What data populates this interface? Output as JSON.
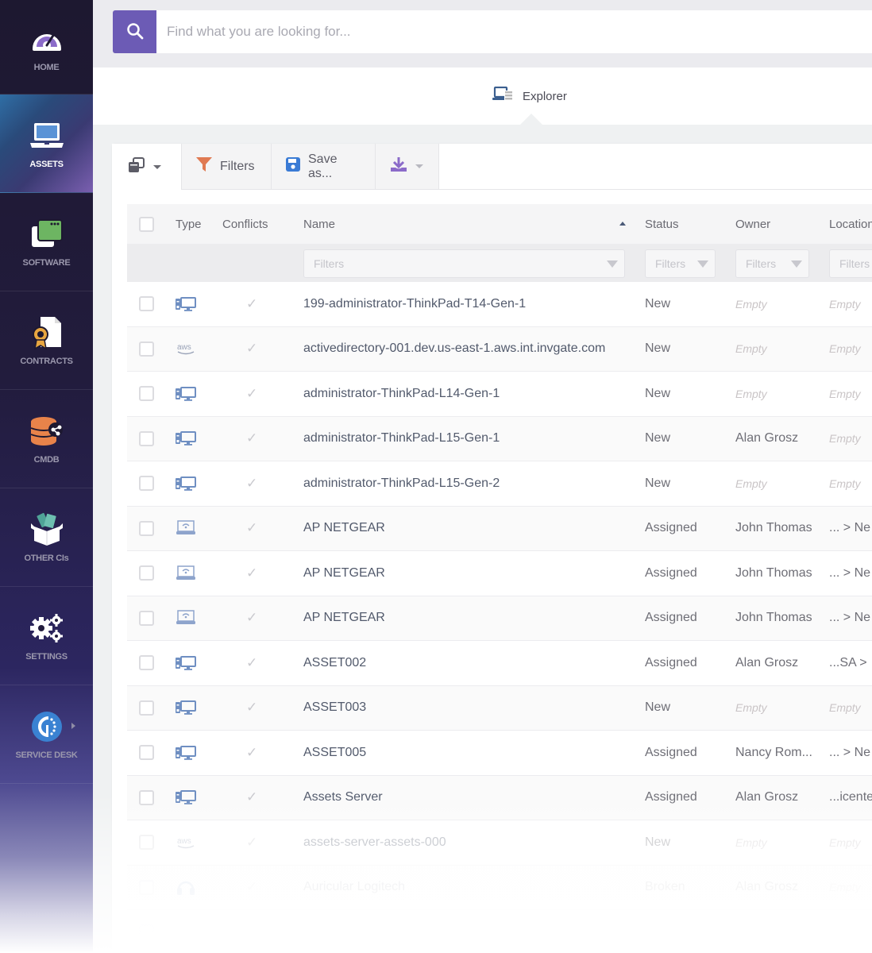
{
  "sidebar": {
    "items": [
      {
        "label": "HOME",
        "icon": "speedometer-icon",
        "active": false
      },
      {
        "label": "ASSETS",
        "icon": "laptop-icon",
        "active": true
      },
      {
        "label": "SOFTWARE",
        "icon": "software-windows-icon",
        "active": false
      },
      {
        "label": "CONTRACTS",
        "icon": "contract-certificate-icon",
        "active": false
      },
      {
        "label": "CMDB",
        "icon": "database-share-icon",
        "active": false
      },
      {
        "label": "OTHER CIs",
        "icon": "open-box-icon",
        "active": false
      },
      {
        "label": "SETTINGS",
        "icon": "gears-icon",
        "active": false
      },
      {
        "label": "SERVICE DESK",
        "icon": "service-desk-logo-icon",
        "active": false,
        "has_submenu": true
      }
    ]
  },
  "search": {
    "placeholder": "Find what you are looking for...",
    "value": "",
    "button_icon": "search-icon",
    "accent_color": "#6c5bb5"
  },
  "tabs": {
    "active": {
      "label": "Explorer",
      "icon": "explorer-icon"
    }
  },
  "toolbar": {
    "view_icon": "view-switch-icon",
    "filters_label": "Filters",
    "save_label": "Save as...",
    "download_icon": "download-icon"
  },
  "table": {
    "columns": [
      {
        "key": "select",
        "label": ""
      },
      {
        "key": "type",
        "label": "Type"
      },
      {
        "key": "conflicts",
        "label": "Conflicts"
      },
      {
        "key": "name",
        "label": "Name",
        "sorted": "ascending"
      },
      {
        "key": "status",
        "label": "Status"
      },
      {
        "key": "owner",
        "label": "Owner"
      },
      {
        "key": "location",
        "label": "Location"
      }
    ],
    "filter_placeholder": "Filters",
    "empty_label": "Empty",
    "rows": [
      {
        "type": "desktop",
        "name": "199-administrator-ThinkPad-T14-Gen-1",
        "status": "New",
        "owner": "Empty",
        "location": "Empty"
      },
      {
        "type": "aws",
        "name": "activedirectory-001.dev.us-east-1.aws.int.invgate.com",
        "status": "New",
        "owner": "Empty",
        "location": "Empty"
      },
      {
        "type": "desktop",
        "name": "administrator-ThinkPad-L14-Gen-1",
        "status": "New",
        "owner": "Empty",
        "location": "Empty"
      },
      {
        "type": "desktop",
        "name": "administrator-ThinkPad-L15-Gen-1",
        "status": "New",
        "owner": "Alan Grosz",
        "location": "Empty"
      },
      {
        "type": "desktop",
        "name": "administrator-ThinkPad-L15-Gen-2",
        "status": "New",
        "owner": "Empty",
        "location": "Empty"
      },
      {
        "type": "access-point",
        "name": "AP NETGEAR",
        "status": "Assigned",
        "owner": "John Thomas",
        "location": "... > Ne"
      },
      {
        "type": "access-point",
        "name": "AP NETGEAR",
        "status": "Assigned",
        "owner": "John Thomas",
        "location": "... > Ne"
      },
      {
        "type": "access-point",
        "name": "AP NETGEAR",
        "status": "Assigned",
        "owner": "John Thomas",
        "location": "... > Ne"
      },
      {
        "type": "desktop",
        "name": "ASSET002",
        "status": "Assigned",
        "owner": "Alan Grosz",
        "location": "...SA >"
      },
      {
        "type": "desktop",
        "name": "ASSET003",
        "status": "New",
        "owner": "Empty",
        "location": "Empty"
      },
      {
        "type": "desktop",
        "name": "ASSET005",
        "status": "Assigned",
        "owner": "Nancy Rom...",
        "location": "... > Ne"
      },
      {
        "type": "desktop",
        "name": "Assets Server",
        "status": "Assigned",
        "owner": "Alan Grosz",
        "location": "...icente"
      },
      {
        "type": "aws",
        "name": "assets-server-assets-000",
        "status": "New",
        "owner": "Empty",
        "location": "Empty"
      },
      {
        "type": "headset",
        "name": "Auricular Logitech",
        "status": "Broken",
        "owner": "Alan Grosz",
        "location": "Empty"
      }
    ]
  }
}
